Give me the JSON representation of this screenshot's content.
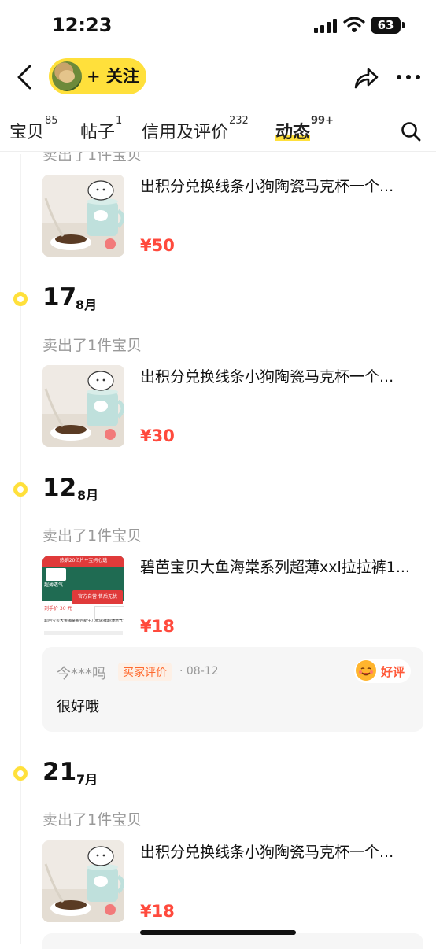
{
  "status_bar": {
    "time": "12:23",
    "battery": "63"
  },
  "nav": {
    "follow_label": "+ 关注"
  },
  "tabs": [
    {
      "label": "宝贝",
      "count": "85"
    },
    {
      "label": "帖子",
      "count": "1"
    },
    {
      "label": "信用及评价",
      "count": "232"
    },
    {
      "label": "动态",
      "count": "99+"
    }
  ],
  "feed": {
    "top_partial": {
      "faded_text": "卖出了1件宝贝",
      "title": "出积分兑换线条小狗陶瓷马克杯一个...",
      "price": "¥50"
    },
    "groups": [
      {
        "day": "17",
        "month": "8月",
        "sold_text": "卖出了1件宝贝",
        "title": "出积分兑换线条小狗陶瓷马克杯一个...",
        "price": "¥30"
      },
      {
        "day": "12",
        "month": "8月",
        "sold_text": "卖出了1件宝贝",
        "title": "碧芭宝贝大鱼海棠系列超薄xxl拉拉裤1...",
        "price": "¥18",
        "thumb_texts": {
          "top": "热销20亿片*·宝妈心选",
          "left": "超薄透气",
          "right": "官方自营 售后无忧",
          "price_line": "到手价 30 元",
          "foot": "碧芭宝贝大鱼海棠系列新生儿纸尿裤超薄透气"
        },
        "review": {
          "user": "今***吗",
          "badge": "买家评价",
          "date": "· 08-12",
          "rating": "好评",
          "text": "很好哦"
        }
      },
      {
        "day": "21",
        "month": "7月",
        "sold_text": "卖出了1件宝贝",
        "title": "出积分兑换线条小狗陶瓷马克杯一个...",
        "price": "¥18"
      }
    ]
  },
  "colors": {
    "accent": "#ffe03b",
    "price": "#ff4a3d",
    "muted": "#999999"
  }
}
